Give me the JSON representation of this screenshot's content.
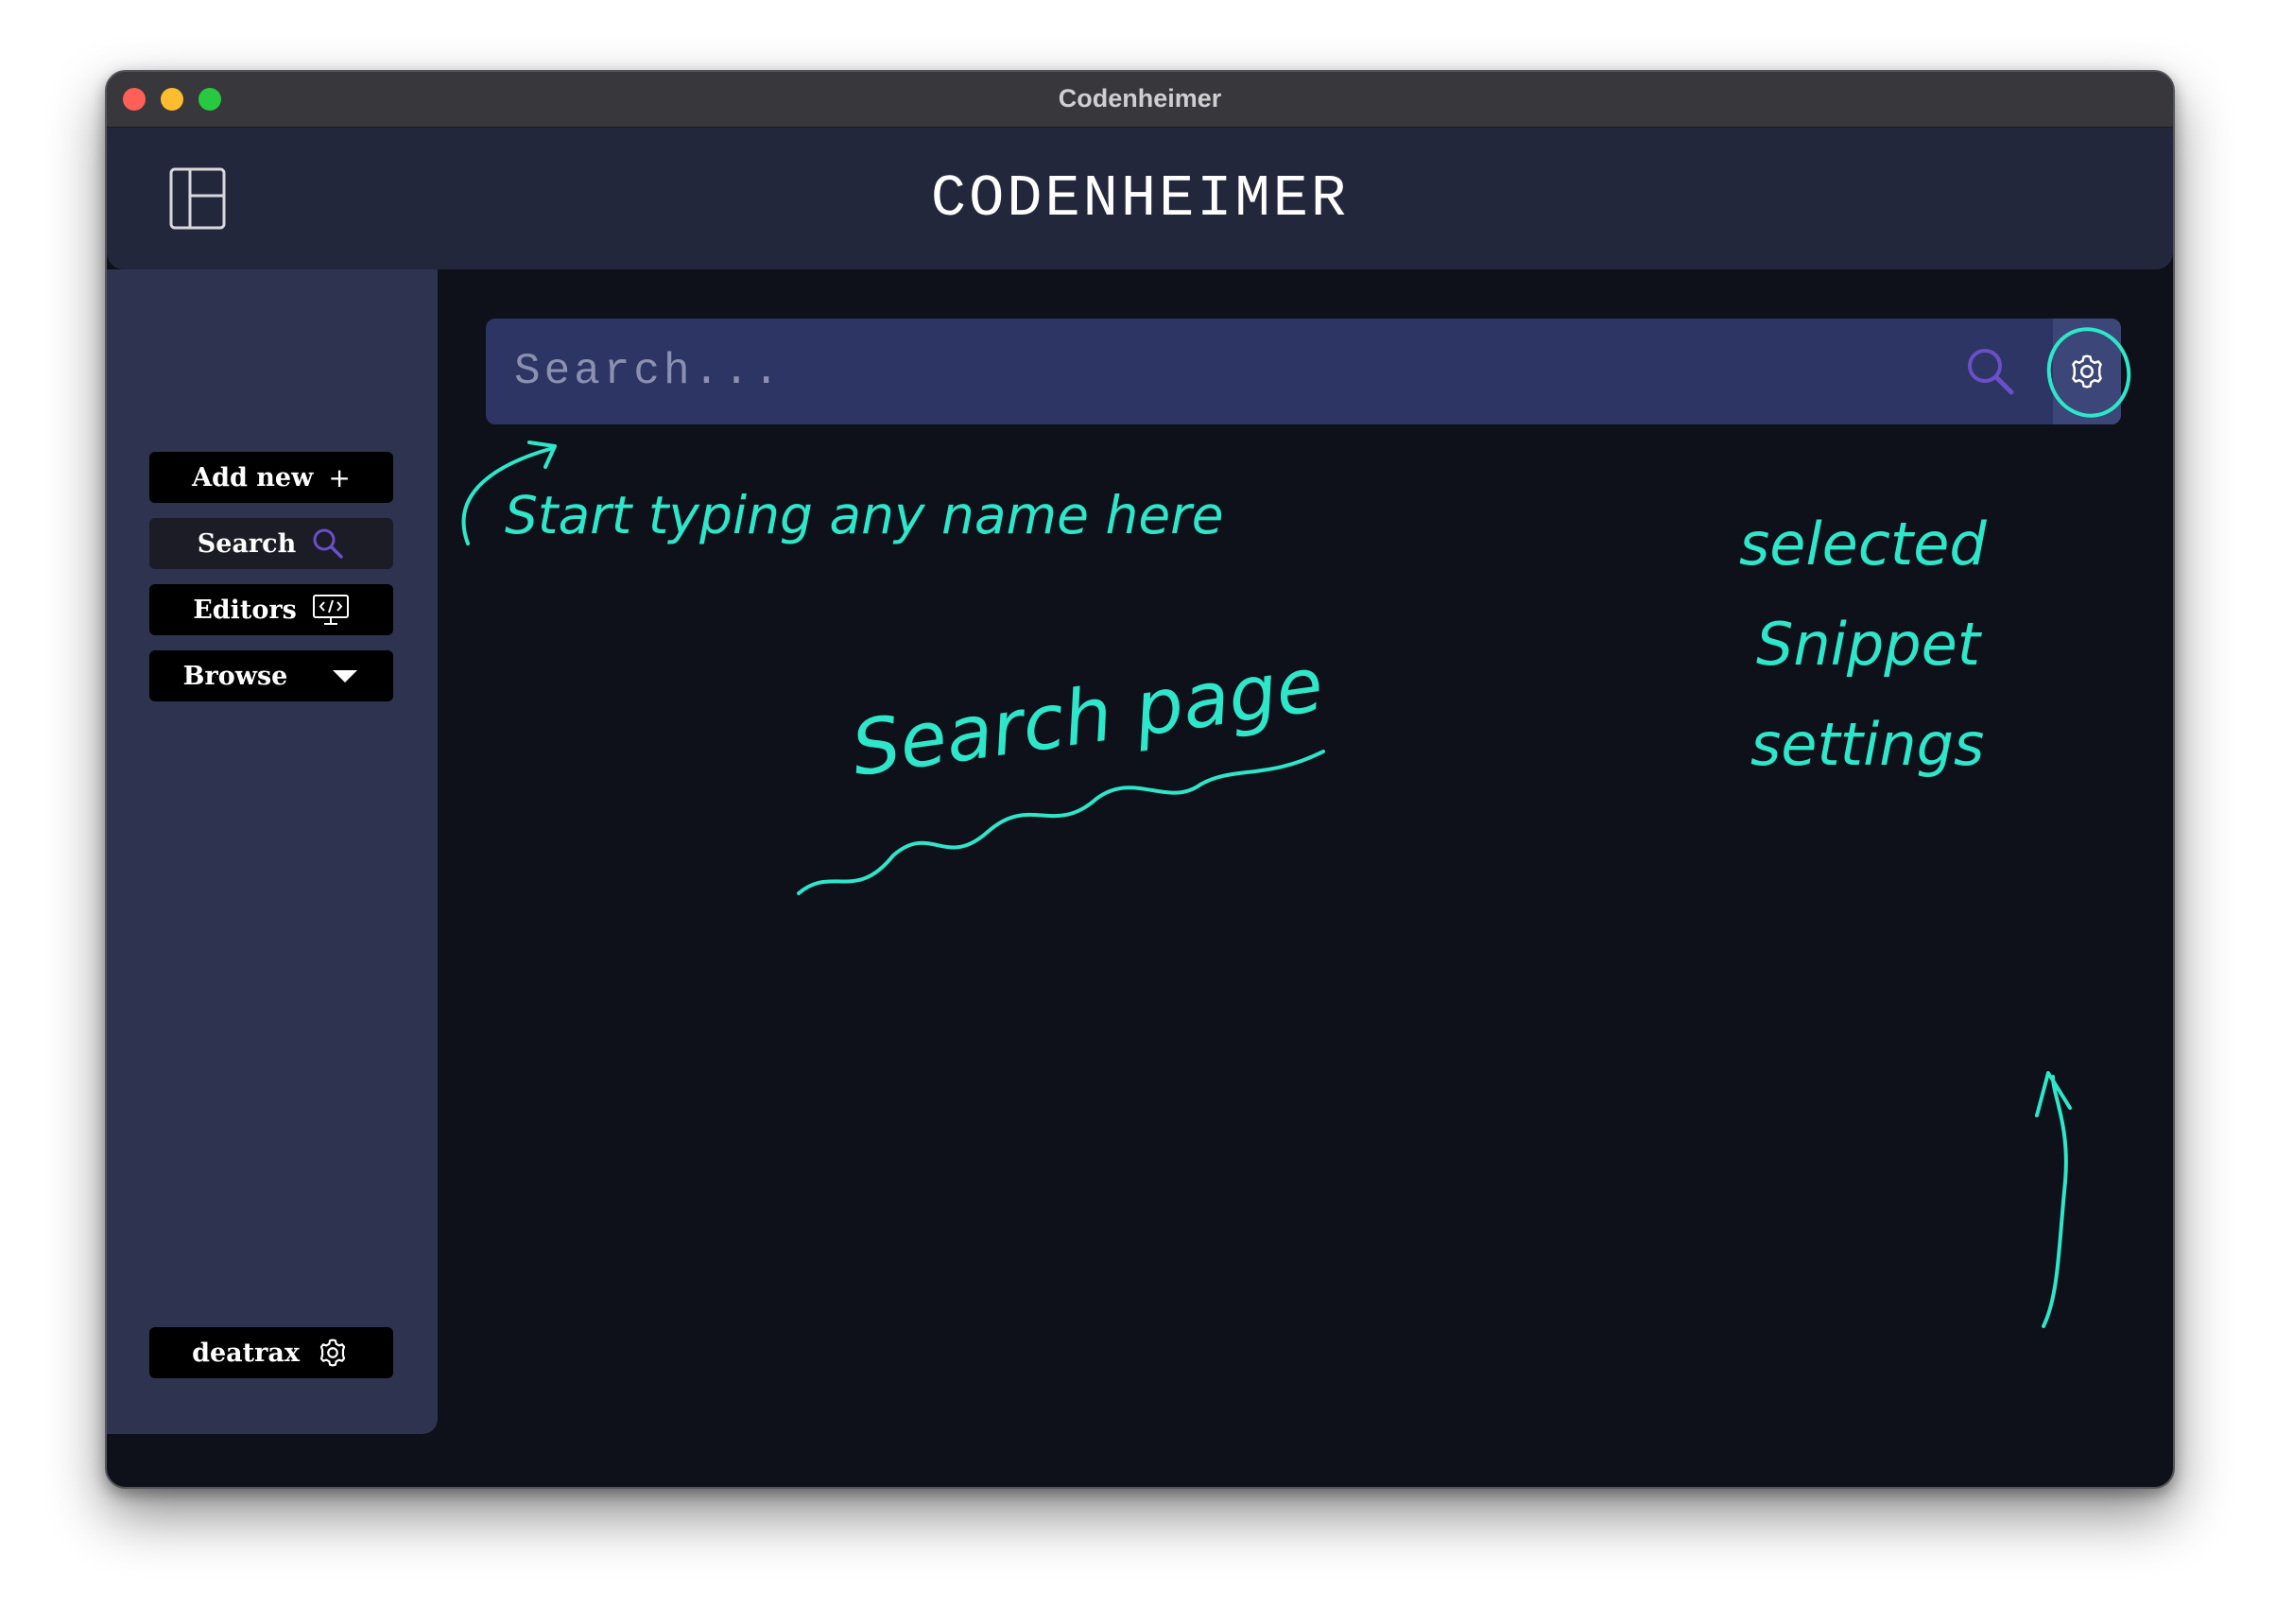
{
  "window": {
    "title": "Codenheimer"
  },
  "header": {
    "app_title": "CODENHEIMER",
    "layout_icon": "layout-icon"
  },
  "sidebar": {
    "items": [
      {
        "label": "Add new",
        "icon": "plus-glyph",
        "icon_glyph": "+"
      },
      {
        "label": "Search",
        "icon": "search-icon",
        "active": true
      },
      {
        "label": "Editors",
        "icon": "code-monitor-icon"
      },
      {
        "label": "Browse",
        "icon": "caret-down-icon"
      }
    ],
    "user": {
      "label": "deatrax",
      "icon": "gear-icon"
    }
  },
  "search": {
    "placeholder": "Search...",
    "value": "",
    "search_icon": "search-icon",
    "settings_icon": "gear-icon"
  },
  "annotations": {
    "typing_hint": "Start typing any name here",
    "page_label": "Search page",
    "settings_hint": [
      "selected",
      "Snippet",
      "settings"
    ]
  },
  "colors": {
    "window_bg": "#0f111a",
    "header_bg": "#23273c",
    "sidebar_bg": "#2e3350",
    "search_bg": "#2c3563",
    "settings_btn_bg": "#3c4679",
    "accent_purple": "#6b4fc9",
    "annotation": "#2ee6c9"
  }
}
